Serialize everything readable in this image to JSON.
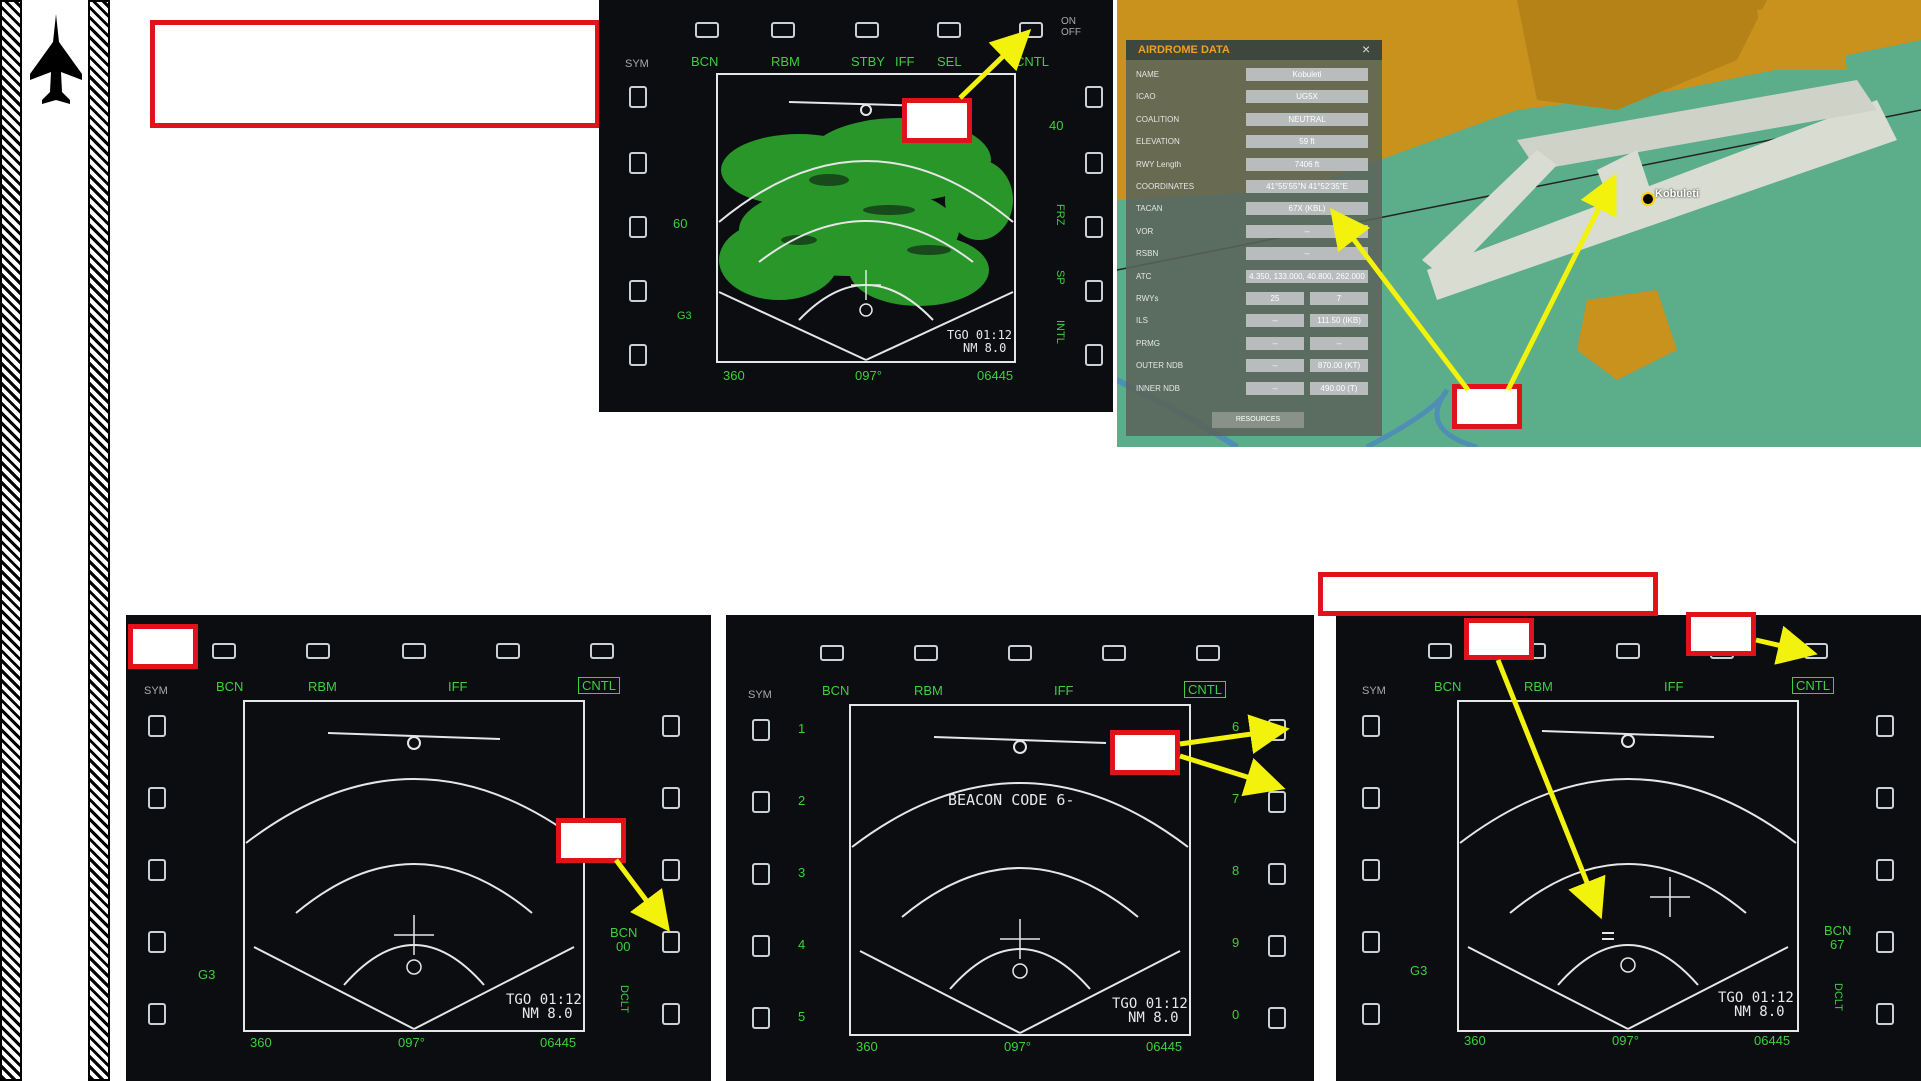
{
  "sidebar": {
    "icon": "jet-silhouette-icon"
  },
  "top_mfd": {
    "topLabels": [
      "BCN",
      "RBM",
      "STBY",
      "IFF",
      "SEL",
      "CNTL"
    ],
    "sym": "SYM",
    "onoff": "ON\nOFF",
    "range": "60",
    "g3": "G3",
    "tgo": "TGO 01:12",
    "nm": "NM  8.0",
    "bottomLeft": "360",
    "bottomMid": "097°",
    "bottomRight": "06445",
    "right40": "40",
    "rightFrz": "FRZ",
    "rightSp": "SP",
    "rightIntl": "INTL"
  },
  "airdrome": {
    "title": "AIRDROME DATA",
    "close": "×",
    "rows": [
      {
        "label": "NAME",
        "value": "Kobuleti"
      },
      {
        "label": "ICAO",
        "value": "UG5X"
      },
      {
        "label": "COALITION",
        "value": "NEUTRAL"
      },
      {
        "label": "ELEVATION",
        "value": "59 ft"
      },
      {
        "label": "RWY Length",
        "value": "7406 ft"
      },
      {
        "label": "COORDINATES",
        "value": "41°55'55\"N 41°52'35\"E"
      },
      {
        "label": "TACAN",
        "value": "67X (KBL)"
      },
      {
        "label": "VOR",
        "value": "--"
      },
      {
        "label": "RSBN",
        "value": "--"
      },
      {
        "label": "ATC",
        "value": "4.350, 133.000, 40.800, 262.000"
      },
      {
        "label": "RWYs",
        "value": "25",
        "value2": "7"
      },
      {
        "label": "ILS",
        "value": "--",
        "value2": "111.50 (IKB)"
      },
      {
        "label": "PRMG",
        "value": "--",
        "value2": "--"
      },
      {
        "label": "OUTER NDB",
        "value": "--",
        "value2": "870.00 (KT)"
      },
      {
        "label": "INNER NDB",
        "value": "--",
        "value2": "490.00 (T)"
      }
    ],
    "resources": "RESOURCES",
    "mapLabel": "Kobuleti"
  },
  "mfd_a": {
    "topLabels": [
      "BCN",
      "RBM",
      "IFF",
      "CNTL"
    ],
    "sym": "SYM",
    "g3": "G3",
    "bcn": "BCN",
    "bcnVal": "00",
    "dclt": "DCLT",
    "tgo": "TGO 01:12",
    "nm": "NM  8.0",
    "bottomLeft": "360",
    "bottomMid": "097°",
    "bottomRight": "06445"
  },
  "mfd_b": {
    "topLabels": [
      "BCN",
      "RBM",
      "IFF",
      "CNTL"
    ],
    "sym": "SYM",
    "leftNums": [
      "1",
      "2",
      "3",
      "4",
      "5"
    ],
    "rightNums": [
      "6",
      "7",
      "8",
      "9",
      "0"
    ],
    "beacon": "BEACON CODE 6-",
    "tgo": "TGO 01:12",
    "nm": "NM  8.0",
    "bottomLeft": "360",
    "bottomMid": "097°",
    "bottomRight": "06445"
  },
  "mfd_c": {
    "topLabels": [
      "BCN",
      "RBM",
      "IFF",
      "CNTL"
    ],
    "sym": "SYM",
    "g3": "G3",
    "bcn": "BCN",
    "bcnVal": "67",
    "dclt": "DCLT",
    "tgo": "TGO 01:12",
    "nm": "NM  8.0",
    "bottomLeft": "360",
    "bottomMid": "097°",
    "bottomRight": "06445"
  },
  "colors": {
    "accent_red": "#e0121c",
    "arrow_yellow": "#f2f20c",
    "mfd_green": "#3ecf3e"
  }
}
